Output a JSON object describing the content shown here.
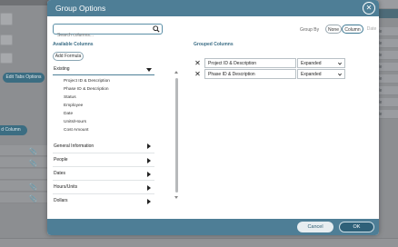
{
  "background": {
    "edit_tabs_button": "Edit Tabs Options",
    "add_column_button": "d Column",
    "right_column_cells": [
      "able",
      "able",
      "able",
      "able",
      "able",
      "able",
      "able",
      "able"
    ],
    "right_header_text": "le"
  },
  "dialog": {
    "title": "Group Options",
    "close_icon": "close-icon",
    "search": {
      "placeholder": "Search columns...",
      "value": ""
    },
    "group_by": {
      "label": "Group By",
      "options": [
        "None",
        "Column",
        "Date"
      ],
      "selected": "Column"
    },
    "available_columns": {
      "title": "Available Columns",
      "add_formula_label": "Add Formula",
      "groups": [
        {
          "label": "Existing",
          "expanded": true,
          "items": [
            "Project ID & Description",
            "Phase ID & Description",
            "Status",
            "Employee",
            "Date",
            "Units/Hours",
            "Cost Amount"
          ]
        },
        {
          "label": "General Information",
          "expanded": false
        },
        {
          "label": "People",
          "expanded": false
        },
        {
          "label": "Dates",
          "expanded": false
        },
        {
          "label": "Hours/Units",
          "expanded": false
        },
        {
          "label": "Dollars",
          "expanded": false
        }
      ]
    },
    "grouped_columns": {
      "title": "Grouped Columns",
      "rows": [
        {
          "name": "Project ID & Description",
          "state": "Expanded"
        },
        {
          "name": "Phase ID & Description",
          "state": "Expanded"
        }
      ]
    },
    "footer": {
      "cancel_label": "Cancel",
      "ok_label": "OK"
    }
  },
  "colors": {
    "header": "#4e7e96",
    "accent": "#3c6e86",
    "ok_button": "#2f6179"
  }
}
